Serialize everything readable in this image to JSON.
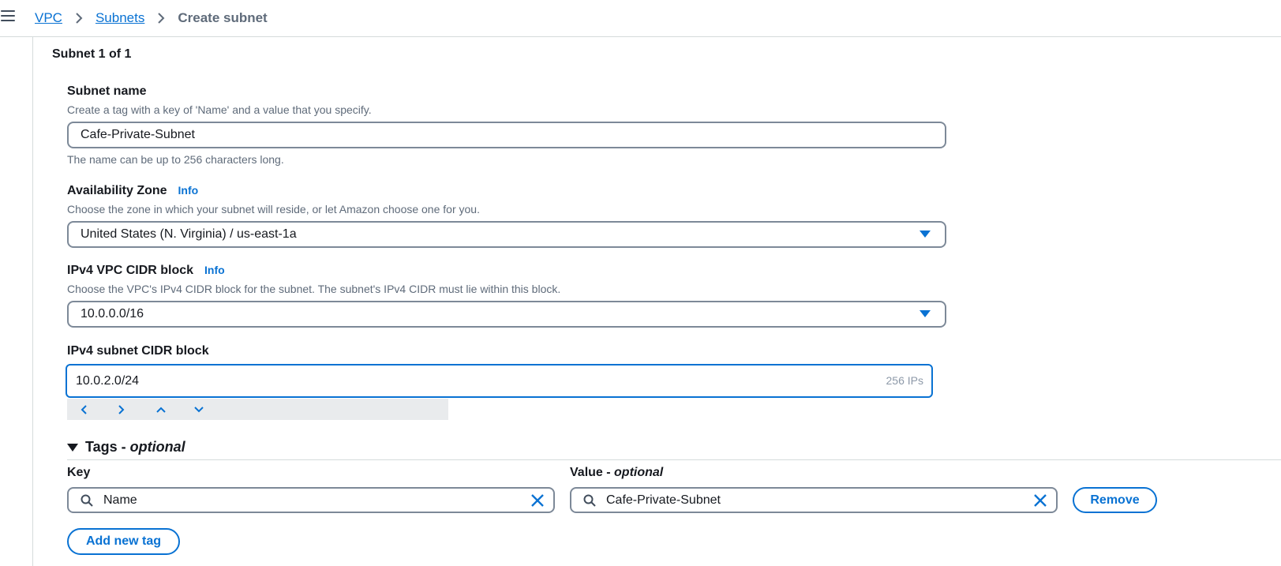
{
  "breadcrumb": {
    "items": [
      {
        "label": "VPC"
      },
      {
        "label": "Subnets"
      }
    ],
    "current": "Create subnet"
  },
  "section": {
    "title": "Subnet 1 of 1"
  },
  "subnet_name": {
    "label": "Subnet name",
    "description": "Create a tag with a key of 'Name' and a value that you specify.",
    "value": "Cafe-Private-Subnet",
    "constraint": "The name can be up to 256 characters long."
  },
  "availability_zone": {
    "label": "Availability Zone",
    "info": "Info",
    "description": "Choose the zone in which your subnet will reside, or let Amazon choose one for you.",
    "value": "United States (N. Virginia) / us-east-1a"
  },
  "vpc_cidr": {
    "label": "IPv4 VPC CIDR block",
    "info": "Info",
    "description": "Choose the VPC's IPv4 CIDR block for the subnet. The subnet's IPv4 CIDR must lie within this block.",
    "value": "10.0.0.0/16"
  },
  "subnet_cidr": {
    "label": "IPv4 subnet CIDR block",
    "value": "10.0.2.0/24",
    "ip_count": "256 IPs"
  },
  "tags": {
    "title": "Tags -",
    "title_suffix": "optional",
    "key_label": "Key",
    "value_label": "Value -",
    "value_label_suffix": "optional",
    "rows": [
      {
        "key": "Name",
        "value": "Cafe-Private-Subnet"
      }
    ],
    "remove_label": "Remove",
    "add_label": "Add new tag"
  },
  "colors": {
    "accent": "#0972d3",
    "text": "#16191f",
    "muted": "#5f6b7a",
    "border": "#7d8998"
  },
  "icons": [
    "menu-icon",
    "chevron-right-icon",
    "caret-down-icon",
    "chevron-left-icon",
    "chevron-up-icon",
    "chevron-down-icon",
    "search-icon",
    "close-icon",
    "triangle-down-icon"
  ]
}
